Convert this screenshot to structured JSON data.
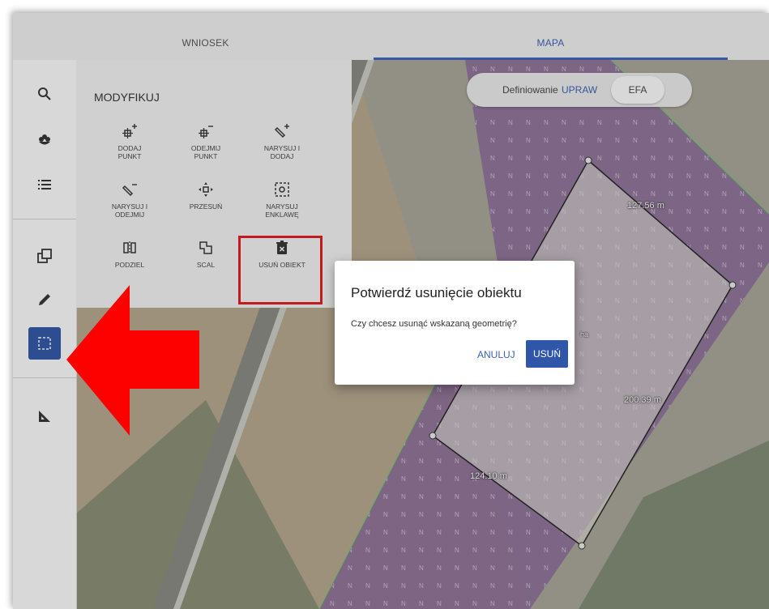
{
  "tabs": [
    {
      "label": "WNIOSEK",
      "active": false
    },
    {
      "label": "MAPA",
      "active": true
    }
  ],
  "sidebar": {
    "items": [
      {
        "icon": "search-icon",
        "active": false
      },
      {
        "icon": "plant-icon",
        "active": false
      },
      {
        "icon": "list-icon",
        "active": false
      },
      {
        "icon": "copy-squares-icon",
        "active": false
      },
      {
        "icon": "pencil-icon",
        "active": false
      },
      {
        "icon": "dashed-rectangle-icon",
        "active": true
      },
      {
        "icon": "ruler-triangle-icon",
        "active": false
      }
    ]
  },
  "panel": {
    "title": "MODYFIKUJ",
    "tools": [
      {
        "label1": "DODAJ",
        "label2": "PUNKT",
        "icon": "add-point-icon"
      },
      {
        "label1": "ODEJMIJ",
        "label2": "PUNKT",
        "icon": "remove-point-icon"
      },
      {
        "label1": "NARYSUJ I",
        "label2": "DODAJ",
        "icon": "draw-add-icon"
      },
      {
        "label1": "NARYSUJ I",
        "label2": "ODEJMIJ",
        "icon": "draw-subtract-icon"
      },
      {
        "label1": "PRZESUŃ",
        "label2": "",
        "icon": "move-icon"
      },
      {
        "label1": "NARYSUJ",
        "label2": "ENKLAWĘ",
        "icon": "enclave-icon"
      },
      {
        "label1": "PODZIEL",
        "label2": "",
        "icon": "split-icon"
      },
      {
        "label1": "SCAL",
        "label2": "",
        "icon": "merge-icon"
      },
      {
        "label1": "USUŃ OBIEKT",
        "label2": "",
        "icon": "trash-icon"
      }
    ]
  },
  "toggle": {
    "prefix": "Definiowanie",
    "upraw": "UPRAW",
    "efa": "EFA"
  },
  "map": {
    "measurements": [
      "127.56 m",
      "200.39 m",
      "124.10 m"
    ],
    "area_unit": "ha"
  },
  "dialog": {
    "title": "Potwierdź usunięcie obiektu",
    "message": "Czy chcesz usunąć wskazaną geometrię?",
    "cancel": "ANULUJ",
    "confirm": "USUŃ"
  },
  "colors": {
    "accent": "#2f56a8",
    "highlight_red": "#e5191e",
    "efa_zone": "#8c6a9a"
  }
}
